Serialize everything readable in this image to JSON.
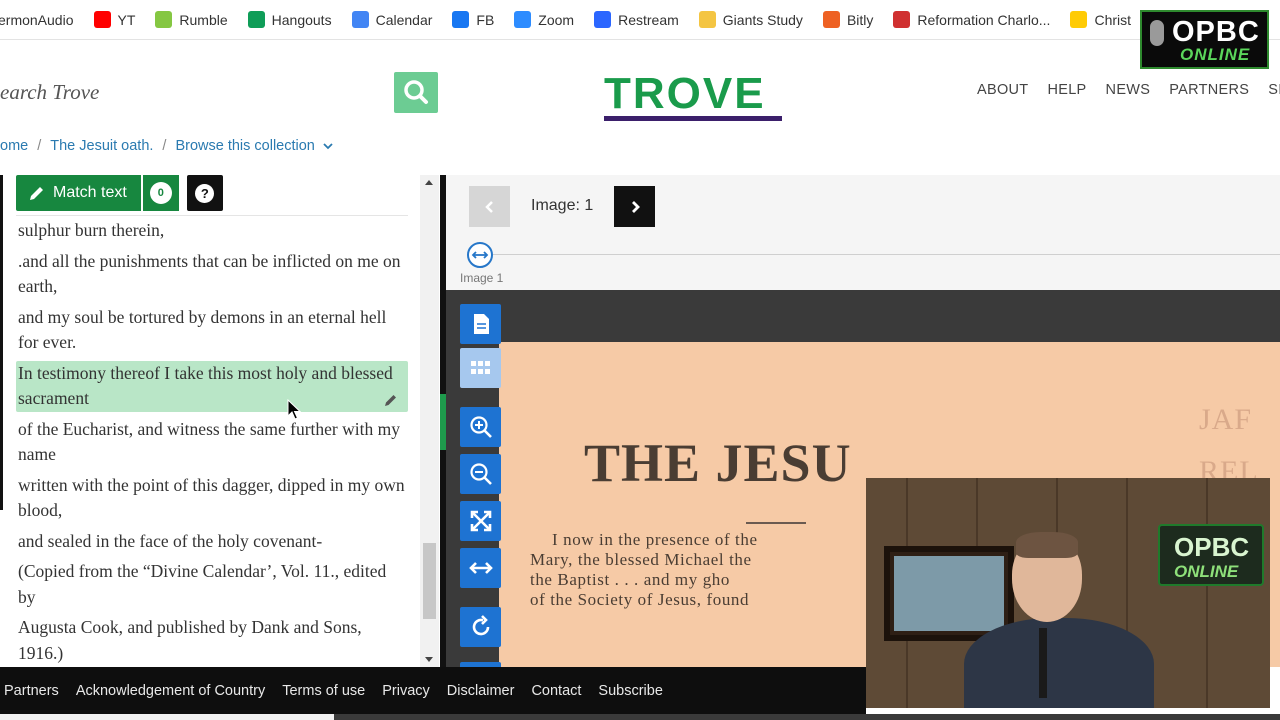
{
  "bookmarks": [
    {
      "label": "ermonAudio",
      "icon": "sermonaudio-icon",
      "color": "#ffffff"
    },
    {
      "label": "YT",
      "icon": "youtube-icon",
      "color": "#ff0000"
    },
    {
      "label": "Rumble",
      "icon": "rumble-icon",
      "color": "#85c742"
    },
    {
      "label": "Hangouts",
      "icon": "hangouts-icon",
      "color": "#0f9d58"
    },
    {
      "label": "Calendar",
      "icon": "calendar-icon",
      "color": "#4285f4"
    },
    {
      "label": "FB",
      "icon": "facebook-icon",
      "color": "#1877f2"
    },
    {
      "label": "Zoom",
      "icon": "zoom-icon",
      "color": "#2d8cff"
    },
    {
      "label": "Restream",
      "icon": "restream-icon",
      "color": "#2b66ff"
    },
    {
      "label": "Giants Study",
      "icon": "folder-icon",
      "color": "#f4c542"
    },
    {
      "label": "Bitly",
      "icon": "bitly-icon",
      "color": "#ee6123"
    },
    {
      "label": "Reformation Charlo...",
      "icon": "reformation-icon",
      "color": "#d03030"
    },
    {
      "label": "Christ",
      "icon": "michigan-icon",
      "color": "#ffcb05"
    }
  ],
  "header": {
    "search_placeholder": "earch Trove",
    "logo_text": "TROVE",
    "nav": [
      "ABOUT",
      "HELP",
      "NEWS",
      "PARTNERS",
      "SIGN"
    ]
  },
  "breadcrumb": {
    "home": "ome",
    "item": "The Jesuit oath.",
    "browse": "Browse this collection"
  },
  "text_panel": {
    "match_label": "Match text",
    "match_count": "0",
    "help_label": "?",
    "lines": [
      "sulphur burn therein,",
      ".and all the punishments that can be inflicted on me on earth,",
      "and my soul be tortured by demons in an eternal hell for ever.",
      "In testimony thereof I take this most holy and blessed sacrament",
      "of the Eucharist, and witness the same further with my name",
      "written with the point of this dagger, dipped in my own blood,",
      "and sealed in the face of the holy covenant-",
      "(Copied from the “Divine Calendar’, Vol. 11., edited by",
      "Augusta Cook, and published by Dank and Sons, 1916.)"
    ],
    "highlighted_index": 3
  },
  "viewer": {
    "image_label": "Image: 1",
    "thumb_caption": "Image 1",
    "doc_title": "THE JESU",
    "doc_body": [
      "I now in the presence of the",
      "Mary, the blessed Michael the",
      "the Baptist . . . and my gho",
      "of the Society of Jesus, found"
    ],
    "doc_stamp": [
      "JAF",
      "REL"
    ]
  },
  "overlay": {
    "badge_line1": "OPBC",
    "badge_line2": "ONLINE"
  },
  "footer": {
    "links": [
      "Partners",
      "Acknowledgement of Country",
      "Terms of use",
      "Privacy",
      "Disclaimer",
      "Contact",
      "Subscribe"
    ]
  }
}
